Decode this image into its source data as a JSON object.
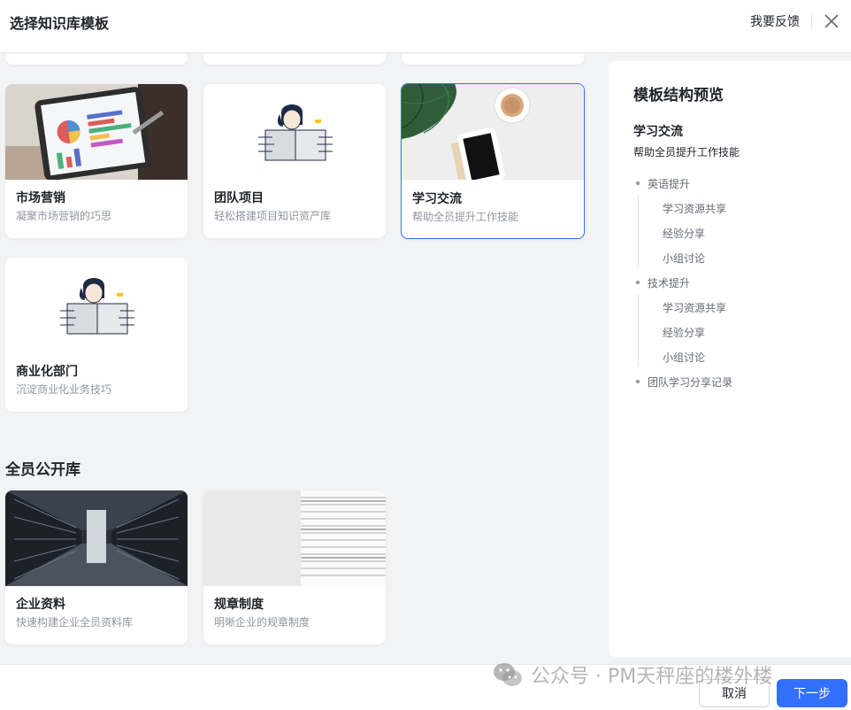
{
  "header": {
    "title": "选择知识库模板",
    "feedback": "我要反馈"
  },
  "templates": [
    {
      "name": "市场营销",
      "desc": "凝聚市场营销的巧思",
      "image": "tablet-chart-photo"
    },
    {
      "name": "团队项目",
      "desc": "轻松搭建项目知识资产库",
      "image": "person-illustration"
    },
    {
      "name": "学习交流",
      "desc": "帮助全员提升工作技能",
      "image": "plant-phone-coffee-photo",
      "selected": true
    },
    {
      "name": "商业化部门",
      "desc": "沉淀商业化业务技巧",
      "image": "person-illustration"
    }
  ],
  "public_section": {
    "title": "全员公开库",
    "templates": [
      {
        "name": "企业资料",
        "desc": "快速构建企业全员资料库",
        "image": "server-room-photo"
      },
      {
        "name": "规章制度",
        "desc": "明晰企业的规章制度",
        "image": "document-stack-photo"
      }
    ]
  },
  "preview": {
    "title": "模板结构预览",
    "name": "学习交流",
    "desc": "帮助全员提升工作技能",
    "tree": [
      {
        "label": "英语提升",
        "children": [
          "学习资源共享",
          "经验分享",
          "小组讨论"
        ]
      },
      {
        "label": "技术提升",
        "children": [
          "学习资源共享",
          "经验分享",
          "小组讨论"
        ]
      },
      {
        "label": "团队学习分享记录",
        "children": []
      }
    ]
  },
  "footer": {
    "cancel": "取消",
    "next": "下一步"
  },
  "watermark": "公众号 · PM天秤座的楼外楼",
  "colors": {
    "accent": "#3370ff",
    "background": "#f2f3f5"
  }
}
